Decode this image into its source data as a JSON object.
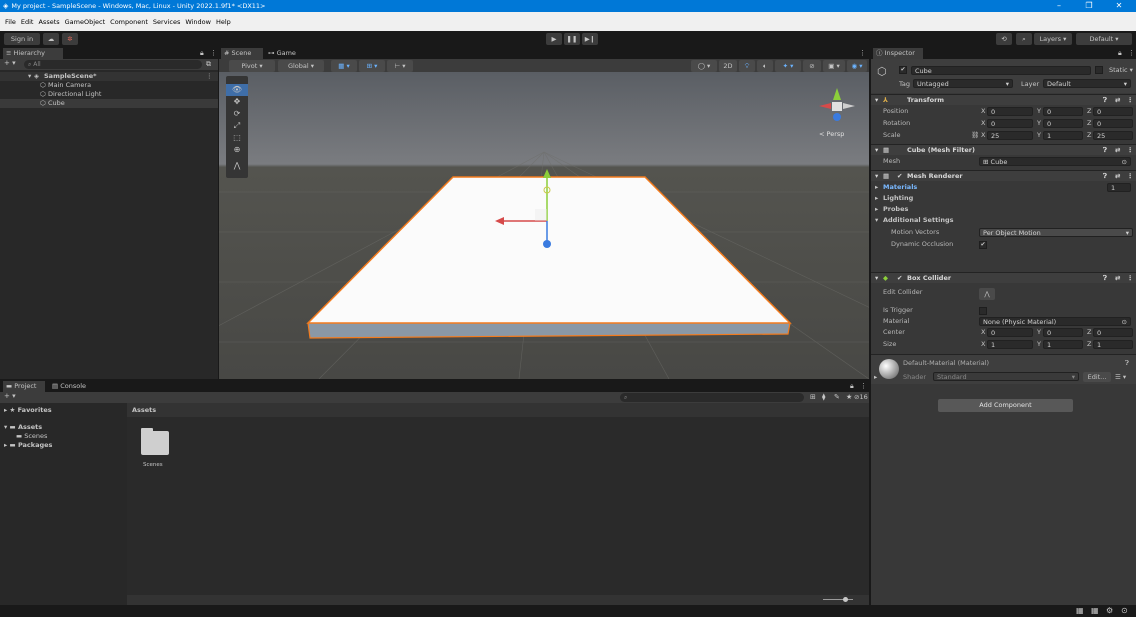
{
  "window": {
    "title": "My project - SampleScene - Windows, Mac, Linux - Unity 2022.1.9f1* <DX11>",
    "minimize": "–",
    "maximize": "❐",
    "close": "✕"
  },
  "menu": [
    "File",
    "Edit",
    "Assets",
    "GameObject",
    "Component",
    "Services",
    "Window",
    "Help"
  ],
  "toolbar": {
    "sign_in": "Sign in",
    "layers": "Layers",
    "layout": "Default"
  },
  "hierarchy": {
    "tab": "Hierarchy",
    "add": "+ ▾",
    "search_placeholder": "All",
    "scene": "SampleScene*",
    "items": [
      "Main Camera",
      "Directional Light",
      "Cube"
    ]
  },
  "scene": {
    "tabs": [
      "Scene",
      "Game"
    ],
    "pivot": "Pivot",
    "global": "Global",
    "mode_2d": "2D",
    "persp": "< Persp"
  },
  "inspector": {
    "tab": "Inspector",
    "object_name": "Cube",
    "static": "Static",
    "tag_label": "Tag",
    "tag_value": "Untagged",
    "layer_label": "Layer",
    "layer_value": "Default",
    "transform": {
      "title": "Transform",
      "rows": [
        {
          "label": "Position",
          "x": "0",
          "y": "0",
          "z": "0"
        },
        {
          "label": "Rotation",
          "x": "0",
          "y": "0",
          "z": "0"
        },
        {
          "label": "Scale",
          "x": "25",
          "y": "1",
          "z": "25"
        }
      ]
    },
    "mesh_filter": {
      "title": "Cube (Mesh Filter)",
      "mesh_label": "Mesh",
      "mesh_value": "Cube"
    },
    "mesh_renderer": {
      "title": "Mesh Renderer",
      "materials": "Materials",
      "materials_count": "1",
      "lighting": "Lighting",
      "probes": "Probes",
      "additional": "Additional Settings",
      "motion_label": "Motion Vectors",
      "motion_value": "Per Object Motion",
      "dyn_label": "Dynamic Occlusion"
    },
    "box_collider": {
      "title": "Box Collider",
      "edit_label": "Edit Collider",
      "trigger_label": "Is Trigger",
      "material_label": "Material",
      "material_value": "None (Physic Material)",
      "center_label": "Center",
      "center": {
        "x": "0",
        "y": "0",
        "z": "0"
      },
      "size_label": "Size",
      "size": {
        "x": "1",
        "y": "1",
        "z": "1"
      }
    },
    "material": {
      "name": "Default-Material (Material)",
      "shader_label": "Shader",
      "shader_value": "Standard",
      "edit": "Edit..."
    },
    "add_component": "Add Component"
  },
  "project": {
    "tabs": [
      "Project",
      "Console"
    ],
    "add": "+ ▾",
    "hidden_count": "16",
    "favorites": "Favorites",
    "tree": [
      "Assets",
      "Scenes",
      "Packages"
    ],
    "breadcrumb": "Assets",
    "folder": "Scenes"
  },
  "colors": {
    "accent": "#0078d7",
    "panel": "#282828",
    "inspector": "#383838",
    "selection": "#f97a1c"
  }
}
